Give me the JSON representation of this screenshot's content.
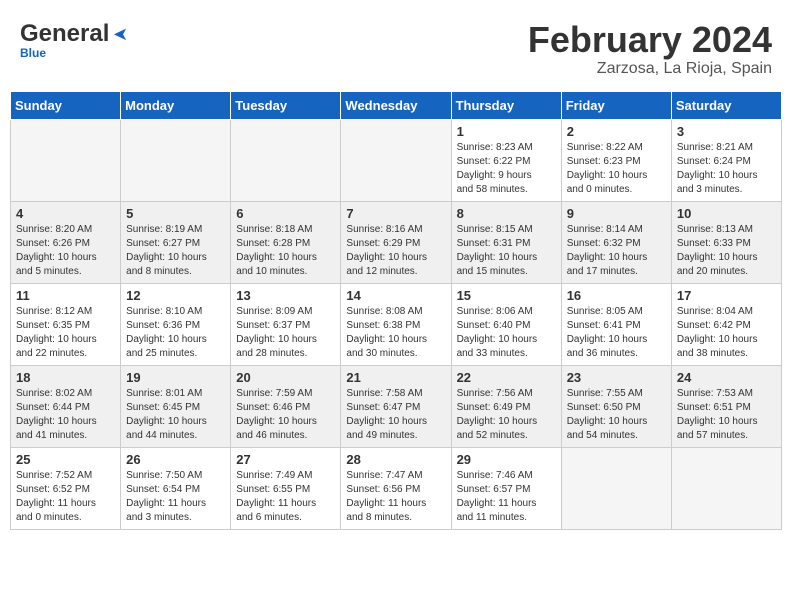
{
  "header": {
    "logo_general": "General",
    "logo_blue": "Blue",
    "month_title": "February 2024",
    "location": "Zarzosa, La Rioja, Spain"
  },
  "weekdays": [
    "Sunday",
    "Monday",
    "Tuesday",
    "Wednesday",
    "Thursday",
    "Friday",
    "Saturday"
  ],
  "weeks": [
    [
      {
        "day": "",
        "info": ""
      },
      {
        "day": "",
        "info": ""
      },
      {
        "day": "",
        "info": ""
      },
      {
        "day": "",
        "info": ""
      },
      {
        "day": "1",
        "info": "Sunrise: 8:23 AM\nSunset: 6:22 PM\nDaylight: 9 hours\nand 58 minutes."
      },
      {
        "day": "2",
        "info": "Sunrise: 8:22 AM\nSunset: 6:23 PM\nDaylight: 10 hours\nand 0 minutes."
      },
      {
        "day": "3",
        "info": "Sunrise: 8:21 AM\nSunset: 6:24 PM\nDaylight: 10 hours\nand 3 minutes."
      }
    ],
    [
      {
        "day": "4",
        "info": "Sunrise: 8:20 AM\nSunset: 6:26 PM\nDaylight: 10 hours\nand 5 minutes."
      },
      {
        "day": "5",
        "info": "Sunrise: 8:19 AM\nSunset: 6:27 PM\nDaylight: 10 hours\nand 8 minutes."
      },
      {
        "day": "6",
        "info": "Sunrise: 8:18 AM\nSunset: 6:28 PM\nDaylight: 10 hours\nand 10 minutes."
      },
      {
        "day": "7",
        "info": "Sunrise: 8:16 AM\nSunset: 6:29 PM\nDaylight: 10 hours\nand 12 minutes."
      },
      {
        "day": "8",
        "info": "Sunrise: 8:15 AM\nSunset: 6:31 PM\nDaylight: 10 hours\nand 15 minutes."
      },
      {
        "day": "9",
        "info": "Sunrise: 8:14 AM\nSunset: 6:32 PM\nDaylight: 10 hours\nand 17 minutes."
      },
      {
        "day": "10",
        "info": "Sunrise: 8:13 AM\nSunset: 6:33 PM\nDaylight: 10 hours\nand 20 minutes."
      }
    ],
    [
      {
        "day": "11",
        "info": "Sunrise: 8:12 AM\nSunset: 6:35 PM\nDaylight: 10 hours\nand 22 minutes."
      },
      {
        "day": "12",
        "info": "Sunrise: 8:10 AM\nSunset: 6:36 PM\nDaylight: 10 hours\nand 25 minutes."
      },
      {
        "day": "13",
        "info": "Sunrise: 8:09 AM\nSunset: 6:37 PM\nDaylight: 10 hours\nand 28 minutes."
      },
      {
        "day": "14",
        "info": "Sunrise: 8:08 AM\nSunset: 6:38 PM\nDaylight: 10 hours\nand 30 minutes."
      },
      {
        "day": "15",
        "info": "Sunrise: 8:06 AM\nSunset: 6:40 PM\nDaylight: 10 hours\nand 33 minutes."
      },
      {
        "day": "16",
        "info": "Sunrise: 8:05 AM\nSunset: 6:41 PM\nDaylight: 10 hours\nand 36 minutes."
      },
      {
        "day": "17",
        "info": "Sunrise: 8:04 AM\nSunset: 6:42 PM\nDaylight: 10 hours\nand 38 minutes."
      }
    ],
    [
      {
        "day": "18",
        "info": "Sunrise: 8:02 AM\nSunset: 6:44 PM\nDaylight: 10 hours\nand 41 minutes."
      },
      {
        "day": "19",
        "info": "Sunrise: 8:01 AM\nSunset: 6:45 PM\nDaylight: 10 hours\nand 44 minutes."
      },
      {
        "day": "20",
        "info": "Sunrise: 7:59 AM\nSunset: 6:46 PM\nDaylight: 10 hours\nand 46 minutes."
      },
      {
        "day": "21",
        "info": "Sunrise: 7:58 AM\nSunset: 6:47 PM\nDaylight: 10 hours\nand 49 minutes."
      },
      {
        "day": "22",
        "info": "Sunrise: 7:56 AM\nSunset: 6:49 PM\nDaylight: 10 hours\nand 52 minutes."
      },
      {
        "day": "23",
        "info": "Sunrise: 7:55 AM\nSunset: 6:50 PM\nDaylight: 10 hours\nand 54 minutes."
      },
      {
        "day": "24",
        "info": "Sunrise: 7:53 AM\nSunset: 6:51 PM\nDaylight: 10 hours\nand 57 minutes."
      }
    ],
    [
      {
        "day": "25",
        "info": "Sunrise: 7:52 AM\nSunset: 6:52 PM\nDaylight: 11 hours\nand 0 minutes."
      },
      {
        "day": "26",
        "info": "Sunrise: 7:50 AM\nSunset: 6:54 PM\nDaylight: 11 hours\nand 3 minutes."
      },
      {
        "day": "27",
        "info": "Sunrise: 7:49 AM\nSunset: 6:55 PM\nDaylight: 11 hours\nand 6 minutes."
      },
      {
        "day": "28",
        "info": "Sunrise: 7:47 AM\nSunset: 6:56 PM\nDaylight: 11 hours\nand 8 minutes."
      },
      {
        "day": "29",
        "info": "Sunrise: 7:46 AM\nSunset: 6:57 PM\nDaylight: 11 hours\nand 11 minutes."
      },
      {
        "day": "",
        "info": ""
      },
      {
        "day": "",
        "info": ""
      }
    ]
  ],
  "shaded_rows": [
    1,
    3
  ]
}
